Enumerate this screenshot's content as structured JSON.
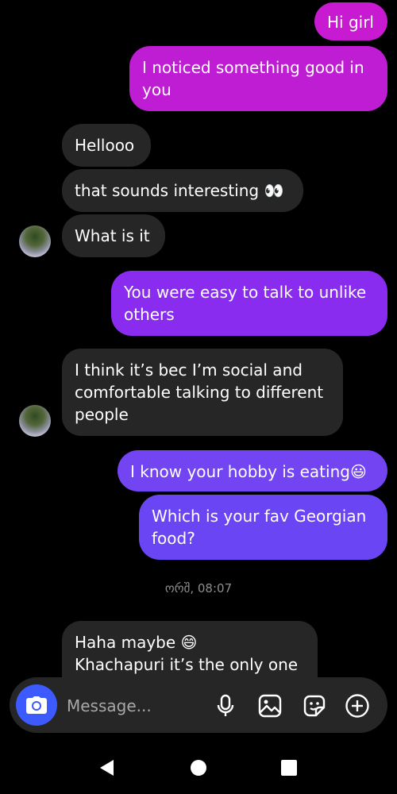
{
  "messages": {
    "m1": "Hi girl",
    "m2": "I noticed something good in\nyou",
    "m3": "Hellooo",
    "m4": "that sounds interesting 👀",
    "m5": "What is it",
    "m6": "You were easy to talk to unlike\nothers",
    "m7": "I think it’s bec I’m social and\ncomfortable talking to different\npeople",
    "m8": "I know your hobby is eating😃",
    "m9": "Which is your fav Georgian\nfood?",
    "m10": "Haha maybe 😄\nKhachapuri it’s the only one"
  },
  "timestamp": "ორშ, 08:07",
  "composer": {
    "placeholder": "Message...",
    "icons": [
      "camera-icon",
      "microphone-icon",
      "gallery-icon",
      "sticker-icon",
      "plus-icon"
    ]
  },
  "colors": {
    "outgoing_top": "#c21ad4",
    "outgoing_mid": "#8a2cf0",
    "outgoing_bottom": "#6a45f3",
    "incoming": "#262626",
    "camera_button": "#3d5afe"
  },
  "navbar": {
    "icons": [
      "back-icon",
      "home-icon",
      "recents-icon"
    ]
  }
}
